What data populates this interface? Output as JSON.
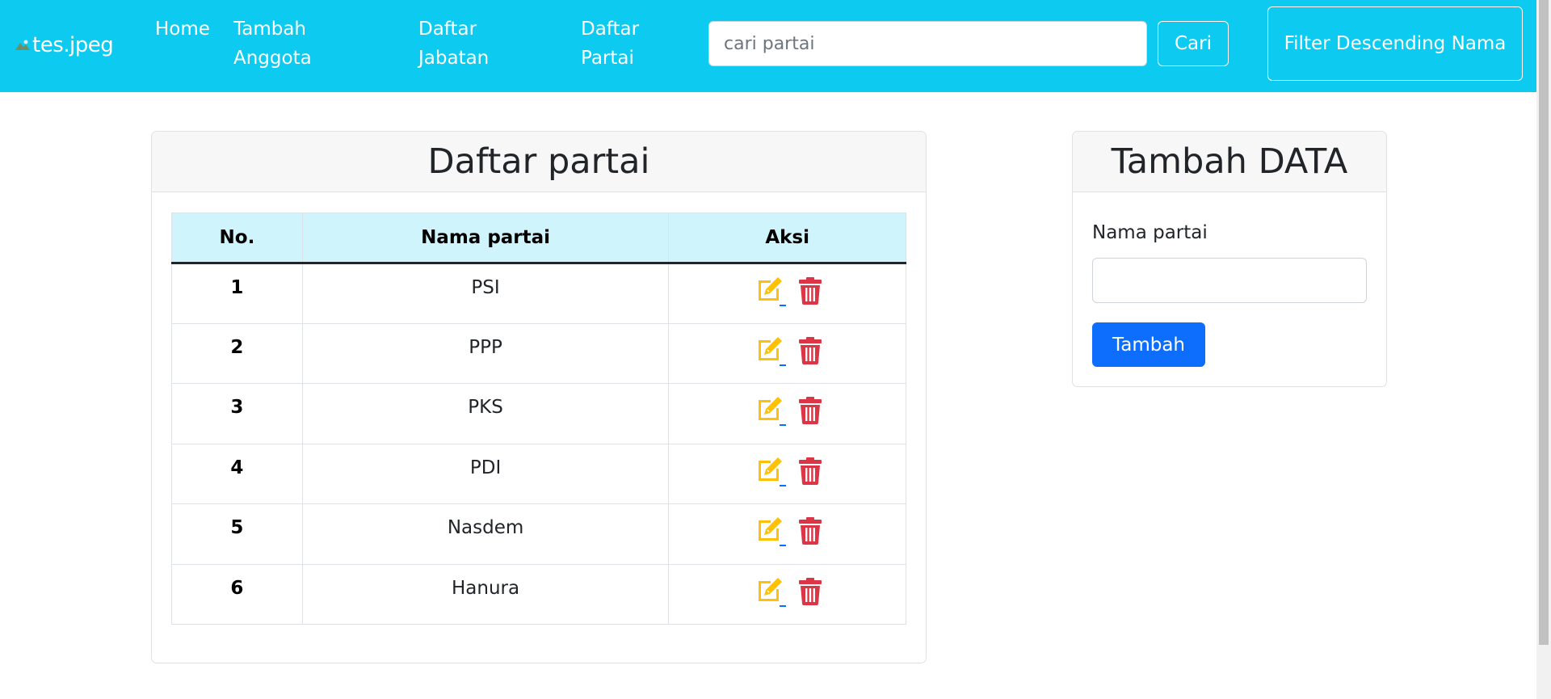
{
  "navbar": {
    "brand_alt": "tes.jpeg",
    "links": {
      "home": "Home",
      "tambah_anggota": "Tambah Anggota",
      "daftar_jabatan": "Daftar Jabatan",
      "daftar_partai": "Daftar Partai"
    },
    "search": {
      "placeholder": "cari partai",
      "value": ""
    },
    "search_button": "Cari",
    "filter_button": "Filter Descending Nama",
    "background_color": "#0dcaf0"
  },
  "list_card": {
    "title": "Daftar partai",
    "table": {
      "headers": [
        "No.",
        "Nama partai",
        "Aksi"
      ],
      "rows": [
        {
          "no": "1",
          "name": "PSI"
        },
        {
          "no": "2",
          "name": "PPP"
        },
        {
          "no": "3",
          "name": "PKS"
        },
        {
          "no": "4",
          "name": "PDI"
        },
        {
          "no": "5",
          "name": "Nasdem"
        },
        {
          "no": "6",
          "name": "Hanura"
        }
      ]
    },
    "icons": {
      "edit": "edit-icon",
      "delete": "trash-icon"
    },
    "colors": {
      "header_bg": "#cff4fc",
      "edit": "#ffc107",
      "delete": "#dc3545"
    }
  },
  "add_card": {
    "title": "Tambah DATA",
    "field_label": "Nama partai",
    "field_value": "",
    "submit_button": "Tambah",
    "button_color": "#0d6efd"
  }
}
